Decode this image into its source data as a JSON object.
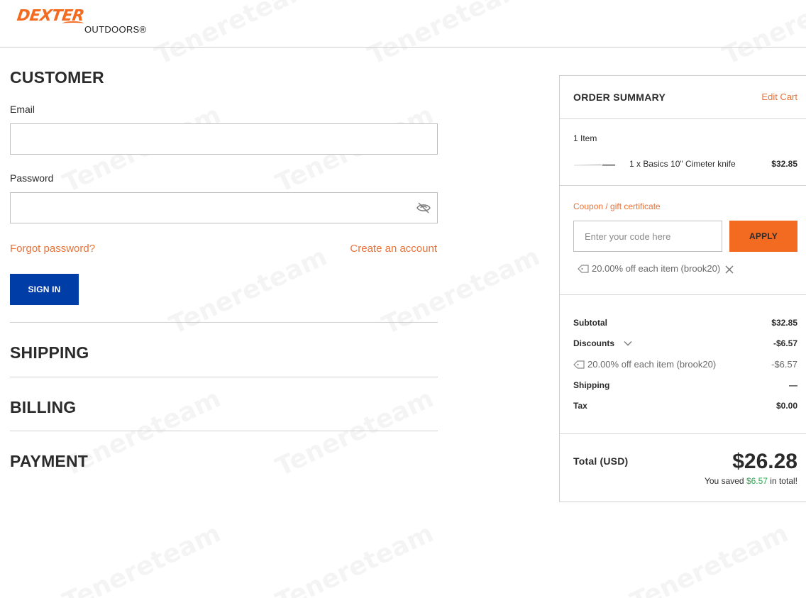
{
  "brand": {
    "logo_main": "DEXTER",
    "logo_sub": "OUTDOORS®",
    "accent": "#f26b21",
    "primary_button": "#003da6"
  },
  "watermark": "Tenereteam",
  "customer": {
    "title": "CUSTOMER",
    "email_label": "Email",
    "email_value": "",
    "password_label": "Password",
    "password_value": "",
    "forgot_password": "Forgot password?",
    "create_account": "Create an account",
    "sign_in": "SIGN IN"
  },
  "sections": {
    "shipping": "SHIPPING",
    "billing": "BILLING",
    "payment": "PAYMENT"
  },
  "summary": {
    "title": "ORDER SUMMARY",
    "edit_cart": "Edit Cart",
    "items_count": "1 Item",
    "item": {
      "name": "1 x Basics 10\" Cimeter knife",
      "price": "$32.85",
      "image_icon": "knife-thumbnail"
    },
    "coupon": {
      "label": "Coupon / gift certificate",
      "placeholder": "Enter your code here",
      "value": "",
      "apply": "APPLY",
      "applied": "20.00% off each item (brook20)"
    },
    "lines": {
      "subtotal_label": "Subtotal",
      "subtotal": "$32.85",
      "discounts_label": "Discounts",
      "discounts": "-$6.57",
      "discount_detail": "20.00% off each item (brook20)",
      "discount_detail_value": "-$6.57",
      "shipping_label": "Shipping",
      "shipping": "—",
      "tax_label": "Tax",
      "tax": "$0.00"
    },
    "total": {
      "label": "Total (USD)",
      "value": "$26.28",
      "saved_prefix": "You saved ",
      "saved_amount": "$6.57",
      "saved_suffix": " in total!"
    }
  }
}
